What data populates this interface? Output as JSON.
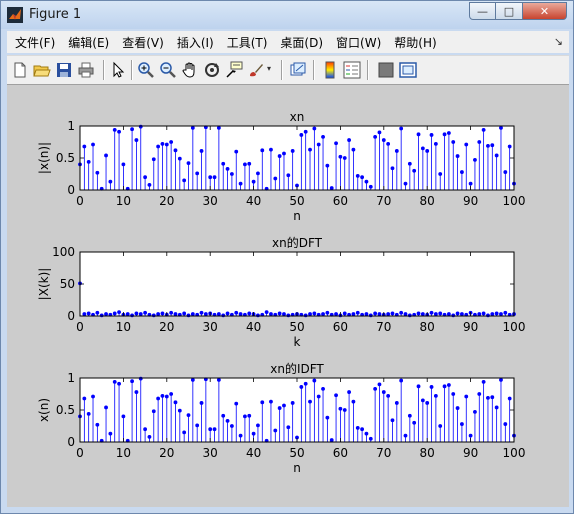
{
  "window": {
    "title": "Figure 1",
    "minimize": "—",
    "maximize": "□",
    "close": "✕"
  },
  "menu": [
    "文件(F)",
    "编辑(E)",
    "查看(V)",
    "插入(I)",
    "工具(T)",
    "桌面(D)",
    "窗口(W)",
    "帮助(H)"
  ],
  "toolbar_icons": [
    "new-figure-icon",
    "open-file-icon",
    "save-icon",
    "print-icon",
    "edit-plot-arrow-icon",
    "zoom-in-icon",
    "zoom-out-icon",
    "pan-hand-icon",
    "rotate-3d-icon",
    "data-cursor-icon",
    "brush-icon",
    "link-plot-icon",
    "colorbar-icon",
    "legend-icon",
    "hide-plot-tools-icon",
    "show-plot-tools-icon"
  ],
  "colors": {
    "stem": "#0000ff",
    "figure_bg": "#cccccc",
    "axes_bg": "#ffffff"
  },
  "chart_data": [
    {
      "type": "stem",
      "title": "xn",
      "xlabel": "n",
      "ylabel": "|x(n)|",
      "xlim": [
        0,
        100
      ],
      "ylim": [
        0,
        1
      ],
      "xticks": [
        0,
        10,
        20,
        30,
        40,
        50,
        60,
        70,
        80,
        90,
        100
      ],
      "yticks": [
        0,
        0.5,
        1
      ],
      "x": [
        0,
        1,
        2,
        3,
        4,
        5,
        6,
        7,
        8,
        9,
        10,
        11,
        12,
        13,
        14,
        15,
        16,
        17,
        18,
        19,
        20,
        21,
        22,
        23,
        24,
        25,
        26,
        27,
        28,
        29,
        30,
        31,
        32,
        33,
        34,
        35,
        36,
        37,
        38,
        39,
        40,
        41,
        42,
        43,
        44,
        45,
        46,
        47,
        48,
        49,
        50,
        51,
        52,
        53,
        54,
        55,
        56,
        57,
        58,
        59,
        60,
        61,
        62,
        63,
        64,
        65,
        66,
        67,
        68,
        69,
        70,
        71,
        72,
        73,
        74,
        75,
        76,
        77,
        78,
        79,
        80,
        81,
        82,
        83,
        84,
        85,
        86,
        87,
        88,
        89,
        90,
        91,
        92,
        93,
        94,
        95,
        96,
        97,
        98,
        99,
        100
      ],
      "values": [
        0.4,
        0.68,
        0.44,
        0.71,
        0.27,
        0.02,
        0.54,
        0.13,
        0.94,
        0.91,
        0.4,
        0.02,
        0.95,
        0.78,
        0.99,
        0.2,
        0.08,
        0.48,
        0.68,
        0.72,
        0.71,
        0.75,
        0.62,
        0.49,
        0.15,
        0.42,
        0.97,
        0.26,
        0.61,
        0.98,
        0.2,
        0.2,
        0.97,
        0.41,
        0.33,
        0.25,
        0.6,
        0.1,
        0.4,
        0.41,
        0.13,
        0.26,
        0.62,
        0.02,
        0.63,
        0.18,
        0.53,
        0.57,
        0.23,
        0.61,
        0.07,
        0.86,
        0.91,
        0.63,
        0.96,
        0.71,
        0.83,
        0.38,
        0.03,
        0.73,
        0.52,
        0.5,
        0.78,
        0.63,
        0.22,
        0.2,
        0.13,
        0.05,
        0.83,
        0.9,
        0.78,
        0.72,
        0.34,
        0.61,
        0.96,
        0.1,
        0.41,
        0.3,
        0.87,
        0.65,
        0.61,
        0.86,
        0.72,
        0.25,
        0.87,
        0.89,
        0.75,
        0.53,
        0.28,
        0.71,
        0.1,
        0.47,
        0.75,
        0.94,
        0.69,
        0.7,
        0.54,
        0.97,
        0.28,
        0.68,
        0.1
      ]
    },
    {
      "type": "stem",
      "title": "xn的DFT",
      "xlabel": "k",
      "ylabel": "|X(k)|",
      "xlim": [
        0,
        100
      ],
      "ylim": [
        0,
        100
      ],
      "xticks": [
        0,
        10,
        20,
        30,
        40,
        50,
        60,
        70,
        80,
        90,
        100
      ],
      "yticks": [
        0,
        50,
        100
      ],
      "x": [
        0,
        1,
        2,
        3,
        4,
        5,
        6,
        7,
        8,
        9,
        10,
        11,
        12,
        13,
        14,
        15,
        16,
        17,
        18,
        19,
        20,
        21,
        22,
        23,
        24,
        25,
        26,
        27,
        28,
        29,
        30,
        31,
        32,
        33,
        34,
        35,
        36,
        37,
        38,
        39,
        40,
        41,
        42,
        43,
        44,
        45,
        46,
        47,
        48,
        49,
        50,
        51,
        52,
        53,
        54,
        55,
        56,
        57,
        58,
        59,
        60,
        61,
        62,
        63,
        64,
        65,
        66,
        67,
        68,
        69,
        70,
        71,
        72,
        73,
        74,
        75,
        76,
        77,
        78,
        79,
        80,
        81,
        82,
        83,
        84,
        85,
        86,
        87,
        88,
        89,
        90,
        91,
        92,
        93,
        94,
        95,
        96,
        97,
        98,
        99,
        100
      ],
      "values": [
        51,
        3,
        4,
        2,
        5,
        1,
        3,
        2,
        4,
        6,
        2,
        3,
        1,
        4,
        3,
        5,
        2,
        1,
        3,
        4,
        2,
        5,
        3,
        2,
        4,
        1,
        3,
        2,
        5,
        3,
        4,
        2,
        3,
        1,
        4,
        2,
        5,
        3,
        2,
        4,
        3,
        1,
        2,
        6,
        3,
        2,
        4,
        3,
        1,
        2,
        3,
        2,
        1,
        3,
        4,
        2,
        3,
        5,
        2,
        3,
        1,
        4,
        2,
        3,
        5,
        2,
        3,
        1,
        4,
        3,
        2,
        3,
        4,
        2,
        5,
        3,
        1,
        2,
        4,
        3,
        2,
        5,
        3,
        4,
        2,
        3,
        1,
        4,
        3,
        2,
        5,
        2,
        3,
        4,
        1,
        3,
        4,
        3,
        5,
        2,
        3
      ]
    },
    {
      "type": "stem",
      "title": "xn的IDFT",
      "xlabel": "n",
      "ylabel": "x(n)",
      "xlim": [
        0,
        100
      ],
      "ylim": [
        0,
        1
      ],
      "xticks": [
        0,
        10,
        20,
        30,
        40,
        50,
        60,
        70,
        80,
        90,
        100
      ],
      "yticks": [
        0,
        0.5,
        1
      ],
      "x": [
        0,
        1,
        2,
        3,
        4,
        5,
        6,
        7,
        8,
        9,
        10,
        11,
        12,
        13,
        14,
        15,
        16,
        17,
        18,
        19,
        20,
        21,
        22,
        23,
        24,
        25,
        26,
        27,
        28,
        29,
        30,
        31,
        32,
        33,
        34,
        35,
        36,
        37,
        38,
        39,
        40,
        41,
        42,
        43,
        44,
        45,
        46,
        47,
        48,
        49,
        50,
        51,
        52,
        53,
        54,
        55,
        56,
        57,
        58,
        59,
        60,
        61,
        62,
        63,
        64,
        65,
        66,
        67,
        68,
        69,
        70,
        71,
        72,
        73,
        74,
        75,
        76,
        77,
        78,
        79,
        80,
        81,
        82,
        83,
        84,
        85,
        86,
        87,
        88,
        89,
        90,
        91,
        92,
        93,
        94,
        95,
        96,
        97,
        98,
        99,
        100
      ],
      "values": [
        0.4,
        0.68,
        0.44,
        0.71,
        0.27,
        0.02,
        0.54,
        0.13,
        0.94,
        0.91,
        0.4,
        0.02,
        0.95,
        0.78,
        0.99,
        0.2,
        0.08,
        0.48,
        0.68,
        0.72,
        0.71,
        0.75,
        0.62,
        0.49,
        0.15,
        0.42,
        0.97,
        0.26,
        0.61,
        0.98,
        0.2,
        0.2,
        0.97,
        0.41,
        0.33,
        0.25,
        0.6,
        0.1,
        0.4,
        0.41,
        0.13,
        0.26,
        0.62,
        0.02,
        0.63,
        0.18,
        0.53,
        0.57,
        0.23,
        0.61,
        0.07,
        0.86,
        0.91,
        0.63,
        0.96,
        0.71,
        0.83,
        0.38,
        0.03,
        0.73,
        0.52,
        0.5,
        0.78,
        0.63,
        0.22,
        0.2,
        0.13,
        0.05,
        0.83,
        0.9,
        0.78,
        0.72,
        0.34,
        0.61,
        0.96,
        0.1,
        0.41,
        0.3,
        0.87,
        0.65,
        0.61,
        0.86,
        0.72,
        0.25,
        0.87,
        0.89,
        0.75,
        0.53,
        0.28,
        0.71,
        0.1,
        0.47,
        0.75,
        0.94,
        0.69,
        0.7,
        0.54,
        0.97,
        0.28,
        0.68,
        0.1
      ]
    }
  ]
}
